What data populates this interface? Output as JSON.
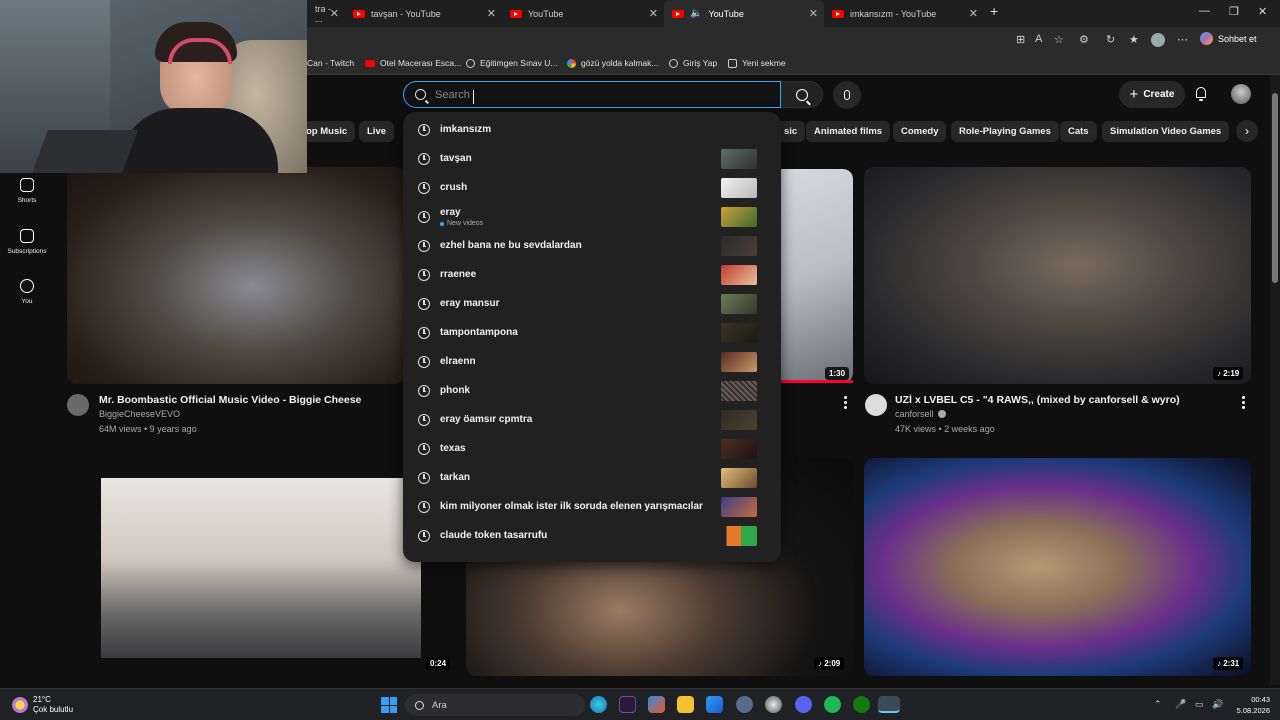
{
  "browser": {
    "tabs": [
      {
        "label": "tra - ...",
        "active": false
      },
      {
        "label": "tavşan - YouTube",
        "active": false
      },
      {
        "label": "YouTube",
        "active": false
      },
      {
        "label": "YouTube",
        "active": true
      },
      {
        "label": "imkansızm - YouTube",
        "active": false
      }
    ],
    "bookmarks": [
      {
        "label": "Can - Twitch",
        "icon": "twitch-icon"
      },
      {
        "label": "Otel Macerası Esca...",
        "icon": "youtube-icon"
      },
      {
        "label": "Eğitimgen Sınav U...",
        "icon": "globe-icon"
      },
      {
        "label": "gözü yolda kalmak...",
        "icon": "google-icon"
      },
      {
        "label": "Giriş Yap",
        "icon": "globe-icon"
      },
      {
        "label": "Yeni sekme",
        "icon": "new-tab-icon"
      }
    ],
    "copilot_label": "Sohbet et"
  },
  "youtube": {
    "search_placeholder": "Search",
    "create_label": "Create",
    "chips": [
      "op Music",
      "Live",
      "sic",
      "Animated films",
      "Comedy",
      "Role-Playing Games",
      "Cats",
      "Simulation Video Games"
    ],
    "sidebar": [
      {
        "label": "Shorts",
        "icon": "shorts-icon"
      },
      {
        "label": "Subscriptions",
        "icon": "subscriptions-icon"
      },
      {
        "label": "You",
        "icon": "you-icon"
      }
    ],
    "suggestions": [
      {
        "text": "imkansızm",
        "sub": ""
      },
      {
        "text": "tavşan",
        "sub": ""
      },
      {
        "text": "crush",
        "sub": ""
      },
      {
        "text": "eray",
        "sub": "New videos"
      },
      {
        "text": "ezhel bana ne bu sevdalardan",
        "sub": ""
      },
      {
        "text": "rraenee",
        "sub": ""
      },
      {
        "text": "eray mansur",
        "sub": ""
      },
      {
        "text": "tampontampona",
        "sub": ""
      },
      {
        "text": "elraenn",
        "sub": ""
      },
      {
        "text": "phonk",
        "sub": ""
      },
      {
        "text": "eray öamsır cpmtra",
        "sub": ""
      },
      {
        "text": "texas",
        "sub": ""
      },
      {
        "text": "tarkan",
        "sub": ""
      },
      {
        "text": "kim milyoner olmak ister ilk soruda elenen yarışmacılar",
        "sub": ""
      },
      {
        "text": "claude token tasarrufu",
        "sub": ""
      }
    ],
    "videos": [
      {
        "title": "Mr. Boombastic Official Music Video - Biggie Cheese",
        "channel": "BiggieCheeseVEVO",
        "meta": "64M views • 9 years ago",
        "duration": ""
      },
      {
        "title": "",
        "channel": "",
        "meta": "",
        "duration": "1:30",
        "watched_fraction": 1.0
      },
      {
        "title": "UZİ x LVBEL C5 - \"4 RAWS,, (mixed by canforsell & wyro)",
        "channel": "canforsell",
        "meta": "47K views • 2 weeks ago",
        "duration": "2:19"
      },
      {
        "title": "",
        "channel": "",
        "meta": "",
        "duration": "0:24"
      },
      {
        "title": "",
        "channel": "",
        "meta": "",
        "duration": "2:09"
      },
      {
        "title": "",
        "channel": "",
        "meta": "",
        "duration": "2:31"
      }
    ]
  },
  "taskbar": {
    "temperature": "21°C",
    "weather": "Çok bulutlu",
    "search_label": "Ara",
    "time": "00:43",
    "date": "5.08.2026"
  },
  "colors": {
    "accent": "#3ea6ff",
    "youtube_red": "#ff0000",
    "background": "#0f0f0f"
  }
}
